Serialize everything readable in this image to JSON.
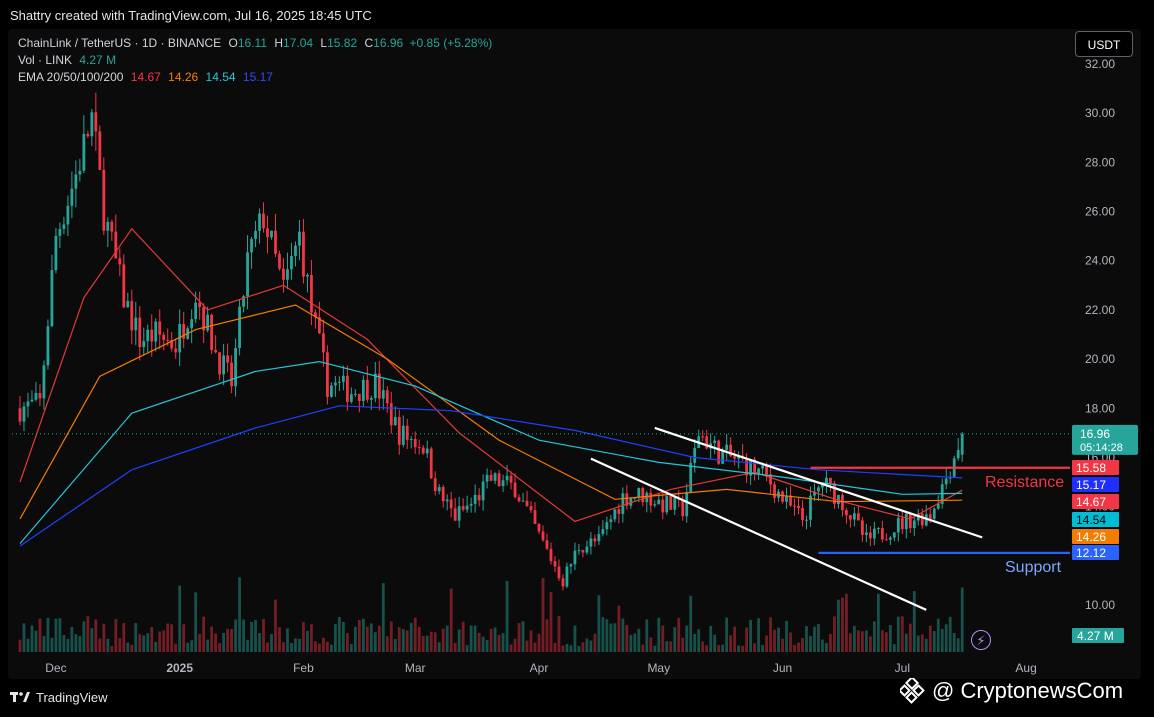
{
  "header": {
    "credit": "Shattry created with TradingView.com, Jul 16, 2025 18:45 UTC"
  },
  "legend": {
    "symbol": "ChainLink / TetherUS · 1D · BINANCE",
    "o_label": "O",
    "o": "16.11",
    "h_label": "H",
    "h": "17.04",
    "l_label": "L",
    "l": "15.82",
    "c_label": "C",
    "c": "16.96",
    "change": "+0.85 (+5.28%)",
    "vol_label": "Vol · LINK",
    "vol": "4.27 M",
    "ema_label": "EMA 20/50/100/200",
    "ema20": "14.67",
    "ema50": "14.26",
    "ema100": "14.54",
    "ema200": "15.17"
  },
  "currency_button": "USDT",
  "footer": {
    "logo": "TradingView",
    "watermark": "@ CryptonewsCom"
  },
  "colors": {
    "up": "#26a69a",
    "down": "#f23645",
    "ema20": "#e53935",
    "ema50": "#f57c00",
    "ema100": "#26c6da",
    "ema200": "#1e40ff",
    "resistance": "#f23645",
    "support": "#2962ff",
    "channel": "#ffffff",
    "last_price": "#26a69a"
  },
  "chart_data": {
    "type": "line",
    "title": "ChainLink / TetherUS · 1D · BINANCE",
    "xlabel": "",
    "ylabel": "",
    "x_ticks": [
      "Dec",
      "2025",
      "Feb",
      "Mar",
      "Apr",
      "May",
      "Jun",
      "Jul",
      "Aug"
    ],
    "y_ticks": [
      "10.00",
      "12.00",
      "14.00",
      "16.00",
      "18.00",
      "20.00",
      "22.00",
      "24.00",
      "26.00",
      "28.00",
      "30.00",
      "32.00"
    ],
    "ylim": [
      9.0,
      32.0
    ],
    "grid": false,
    "candle_close_series": {
      "name": "LINKUSDT",
      "dates": [
        "2024-11-22",
        "2024-11-27",
        "2024-12-01",
        "2024-12-06",
        "2024-12-10",
        "2024-12-13",
        "2024-12-18",
        "2024-12-22",
        "2024-12-26",
        "2024-12-31",
        "2025-01-05",
        "2025-01-10",
        "2025-01-14",
        "2025-01-18",
        "2025-01-22",
        "2025-01-27",
        "2025-01-31",
        "2025-02-03",
        "2025-02-07",
        "2025-02-13",
        "2025-02-19",
        "2025-02-25",
        "2025-03-03",
        "2025-03-07",
        "2025-03-11",
        "2025-03-15",
        "2025-03-20",
        "2025-03-26",
        "2025-04-01",
        "2025-04-07",
        "2025-04-11",
        "2025-04-16",
        "2025-04-22",
        "2025-04-27",
        "2025-05-02",
        "2025-05-07",
        "2025-05-11",
        "2025-05-16",
        "2025-05-22",
        "2025-05-28",
        "2025-06-02",
        "2025-06-06",
        "2025-06-11",
        "2025-06-16",
        "2025-06-22",
        "2025-06-28",
        "2025-07-03",
        "2025-07-08",
        "2025-07-12",
        "2025-07-16"
      ],
      "values": [
        18.0,
        18.2,
        25.0,
        27.5,
        29.8,
        26.0,
        22.5,
        20.8,
        21.0,
        20.6,
        22.7,
        20.3,
        19.0,
        24.0,
        25.8,
        22.8,
        25.0,
        22.0,
        19.0,
        18.7,
        19.0,
        17.0,
        16.5,
        14.5,
        13.6,
        14.1,
        15.1,
        14.8,
        12.8,
        11.0,
        12.4,
        12.6,
        14.4,
        14.5,
        14.1,
        13.9,
        17.0,
        16.2,
        15.8,
        15.2,
        14.1,
        13.5,
        15.0,
        14.2,
        12.6,
        13.1,
        13.5,
        13.7,
        15.2,
        16.96
      ]
    },
    "ema_lines": [
      {
        "name": "EMA 20",
        "value": "14.67",
        "dates": [
          "2024-11-22",
          "2024-12-08",
          "2024-12-20",
          "2025-01-08",
          "2025-01-27",
          "2025-02-17",
          "2025-03-12",
          "2025-04-10",
          "2025-05-04",
          "2025-05-25",
          "2025-06-16",
          "2025-07-03",
          "2025-07-16"
        ],
        "values": [
          15.0,
          22.5,
          25.3,
          22.0,
          23.0,
          20.8,
          17.0,
          13.4,
          14.7,
          15.4,
          14.2,
          13.5,
          14.67
        ]
      },
      {
        "name": "EMA 50",
        "value": "14.26",
        "dates": [
          "2024-11-22",
          "2024-12-12",
          "2025-01-05",
          "2025-01-30",
          "2025-02-22",
          "2025-03-22",
          "2025-04-20",
          "2025-05-18",
          "2025-06-15",
          "2025-07-16"
        ],
        "values": [
          13.5,
          19.3,
          21.2,
          22.2,
          20.0,
          16.7,
          14.3,
          14.7,
          14.2,
          14.26
        ]
      },
      {
        "name": "EMA 100",
        "value": "14.54",
        "dates": [
          "2024-11-22",
          "2024-12-20",
          "2025-01-20",
          "2025-02-05",
          "2025-03-01",
          "2025-04-01",
          "2025-05-01",
          "2025-06-01",
          "2025-07-01",
          "2025-07-16"
        ],
        "values": [
          12.5,
          17.8,
          19.5,
          19.9,
          18.9,
          16.7,
          15.8,
          15.2,
          14.5,
          14.54
        ]
      },
      {
        "name": "EMA 200",
        "value": "15.17",
        "dates": [
          "2024-11-22",
          "2024-12-20",
          "2025-01-20",
          "2025-02-10",
          "2025-03-10",
          "2025-04-10",
          "2025-05-10",
          "2025-06-10",
          "2025-07-16"
        ],
        "values": [
          12.4,
          15.5,
          17.2,
          18.1,
          17.9,
          17.1,
          16.0,
          15.5,
          15.17
        ]
      }
    ],
    "price_labels": [
      "15.58",
      "15.17",
      "14.67",
      "14.54",
      "14.26",
      "12.12"
    ],
    "last_price": {
      "value": "16.96",
      "countdown": "05:14:28"
    },
    "volume_last": "4.27 M",
    "annotations": [
      {
        "label": "Resistance",
        "value": 15.58
      },
      {
        "label": "Support",
        "value": 12.12
      }
    ],
    "channel_upper": {
      "start": [
        "2025-04-30",
        17.2
      ],
      "end": [
        "2025-07-21",
        12.75
      ]
    },
    "channel_lower": {
      "start": [
        "2025-04-14",
        15.95
      ],
      "end": [
        "2025-07-07",
        9.8
      ]
    }
  }
}
